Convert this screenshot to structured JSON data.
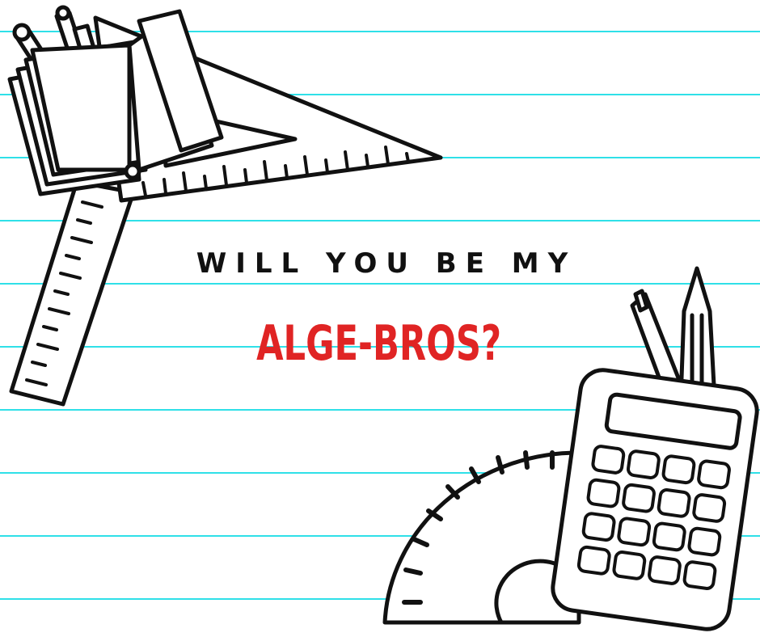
{
  "headline": {
    "line1": "WILL YOU BE MY",
    "line2": "ALGE-BROS?"
  },
  "colors": {
    "background": "#ffffff",
    "ruled_line": "#2fe0e8",
    "ink": "#111111",
    "accent": "#e02424"
  },
  "icons": [
    "notebook-icon",
    "pencil-icon",
    "set-square-icon",
    "ruler-icon",
    "protractor-icon",
    "calculator-icon",
    "marker-icon"
  ]
}
